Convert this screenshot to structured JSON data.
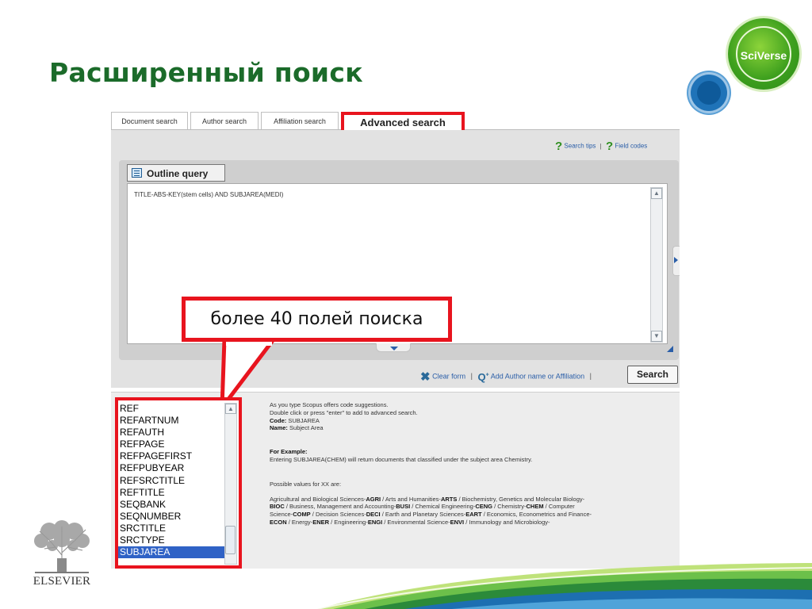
{
  "slide": {
    "title": "Расширенный поиск",
    "callout": "более 40 полей поиска"
  },
  "logo": {
    "name": "SciVerse"
  },
  "publisher": {
    "name": "ELSEVIER"
  },
  "tabs": [
    {
      "label": "Document search"
    },
    {
      "label": "Author search"
    },
    {
      "label": "Affiliation search"
    },
    {
      "label": "Advanced search",
      "active": true
    }
  ],
  "tips": {
    "search_tips": "Search tips",
    "separator": "|",
    "field_codes": "Field codes"
  },
  "query": {
    "outline_label": "Outline query",
    "value": "TITLE-ABS-KEY(stem cells) AND SUBJAREA(MEDI)"
  },
  "actions": {
    "clear": "Clear form",
    "separator": "|",
    "add_author": "Add Author name or Affiliation",
    "search": "Search"
  },
  "field_list": {
    "items": [
      "REF",
      "REFARTNUM",
      "REFAUTH",
      "REFPAGE",
      "REFPAGEFIRST",
      "REFPUBYEAR",
      "REFSRCTITLE",
      "REFTITLE",
      "SEQBANK",
      "SEQNUMBER",
      "SRCTITLE",
      "SRCTYPE",
      "SUBJAREA"
    ],
    "selected": "SUBJAREA"
  },
  "help": {
    "line1": "As you type Scopus offers code suggestions.",
    "line2": "Double click or press \"enter\" to add to advanced search.",
    "code_label": "Code:",
    "code_value": "SUBJAREA",
    "name_label": "Name:",
    "name_value": "Subject Area",
    "example_title": "For Example:",
    "example_text": "Entering SUBJAREA(CHEM) will return documents that classified under the subject area Chemistry.",
    "possible": "Possible values for XX are:",
    "values_text": [
      {
        "t": "Agricultural and Biological Sciences-"
      },
      {
        "b": "AGRI"
      },
      {
        "t": " / Arts and Humanities-"
      },
      {
        "b": "ARTS"
      },
      {
        "t": " / Biochemistry, Genetics and Molecular Biology-"
      },
      {
        "b": "BIOC"
      },
      {
        "t": " / Business, Management and Accounting-"
      },
      {
        "b": "BUSI"
      },
      {
        "t": " / Chemical Engineering-"
      },
      {
        "b": "CENG"
      },
      {
        "t": " / Chemistry-"
      },
      {
        "b": "CHEM"
      },
      {
        "t": " / Computer Science-"
      },
      {
        "b": "COMP"
      },
      {
        "t": " / Decision Sciences-"
      },
      {
        "b": "DECI"
      },
      {
        "t": " / Earth and Planetary Sciences-"
      },
      {
        "b": "EART"
      },
      {
        "t": " / Economics, Econometrics and Finance-"
      },
      {
        "b": "ECON"
      },
      {
        "t": " / Energy-"
      },
      {
        "b": "ENER"
      },
      {
        "t": " / Engineering-"
      },
      {
        "b": "ENGI"
      },
      {
        "t": " / Environmental Science-"
      },
      {
        "b": "ENVI"
      },
      {
        "t": " / Immunology and Microbiology-"
      }
    ]
  }
}
